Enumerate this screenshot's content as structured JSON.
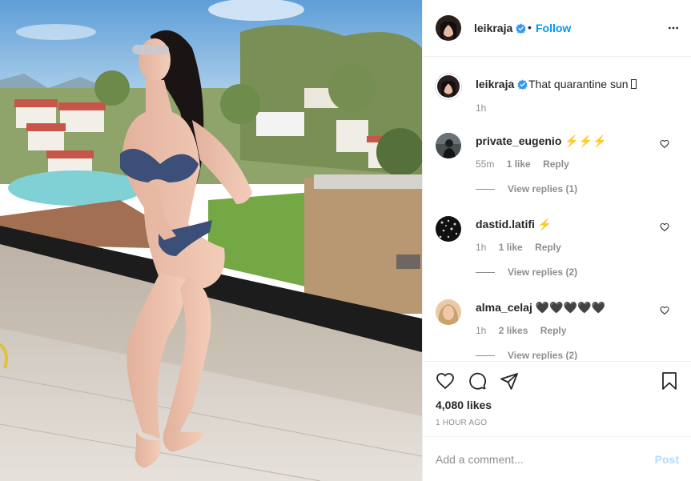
{
  "post": {
    "author": "leikraja",
    "follow_label": "Follow",
    "separator": "•",
    "caption_text": "That quarantine sun ",
    "caption_time": "1h",
    "likes": "4,080 likes",
    "posted_ago": "1 HOUR AGO"
  },
  "comments": [
    {
      "user": "private_eugenio",
      "text": "⚡⚡⚡",
      "time": "55m",
      "likes": "1 like",
      "reply_label": "Reply",
      "view_replies": "View replies (1)"
    },
    {
      "user": "dastid.latifi",
      "text": "⚡",
      "time": "1h",
      "likes": "1 like",
      "reply_label": "Reply",
      "view_replies": "View replies (2)"
    },
    {
      "user": "alma_celaj",
      "text": "🖤🖤🖤🖤🖤",
      "time": "1h",
      "likes": "2 likes",
      "reply_label": "Reply",
      "view_replies": "View replies (2)"
    }
  ],
  "add_comment": {
    "placeholder": "Add a comment...",
    "post_label": "Post"
  },
  "icons": {
    "more": "more-horizontal-icon",
    "verified": "verified-badge-icon",
    "heart": "heart-icon",
    "comment": "comment-icon",
    "share": "share-icon",
    "save": "bookmark-icon"
  },
  "colors": {
    "link_blue": "#0095f6",
    "post_disabled": "#b3dbff",
    "muted": "#8e8e8e",
    "text": "#262626",
    "border": "#efefef"
  }
}
